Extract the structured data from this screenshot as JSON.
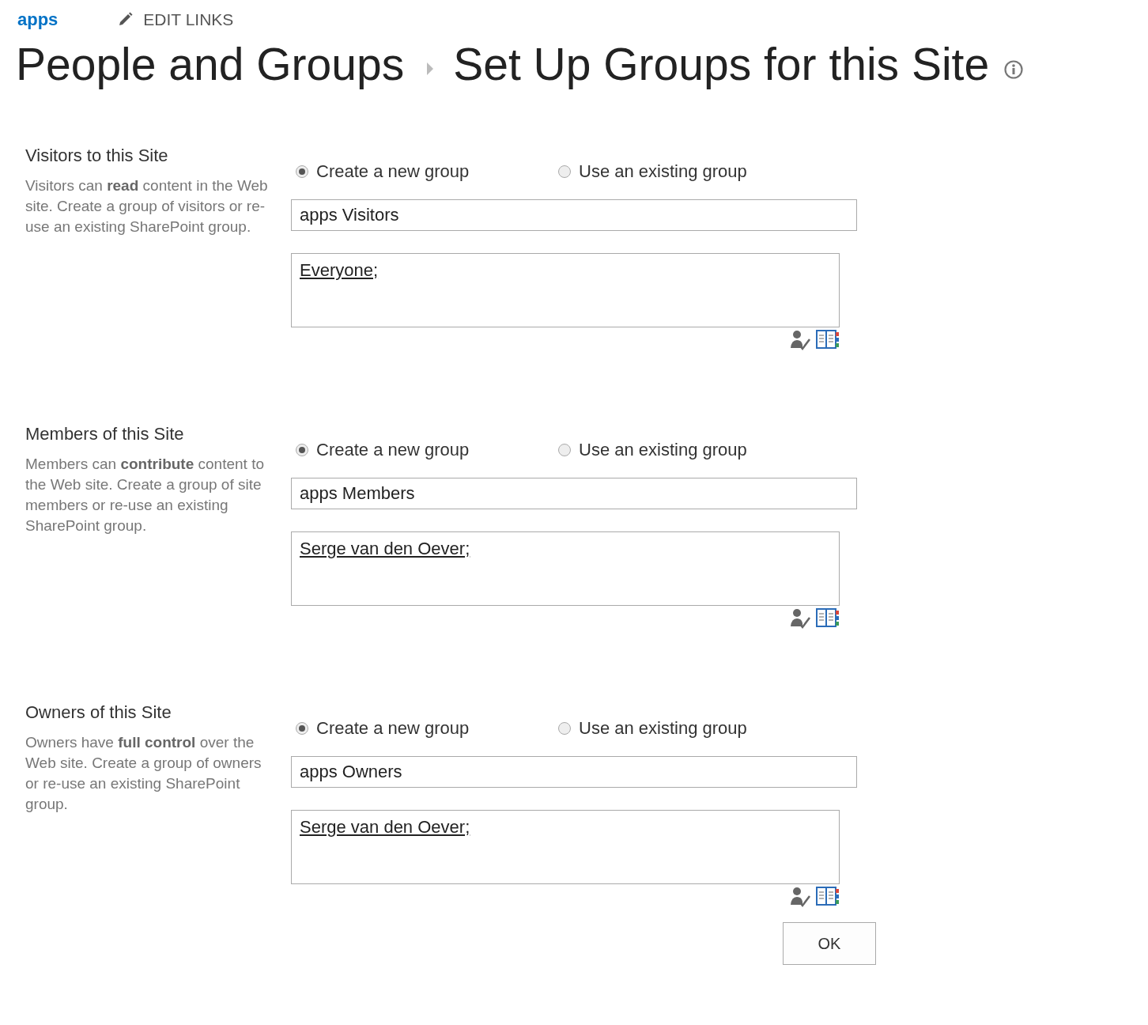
{
  "top_bar": {
    "site_link": "apps",
    "edit_links": "EDIT LINKS"
  },
  "breadcrumb": [
    "People and Groups",
    "Set Up Groups for this Site"
  ],
  "sections": [
    {
      "title": "Visitors to this Site",
      "description": "Visitors can **read** content in the Web site. Create a group of visitors or re-use an existing SharePoint group.",
      "options": [
        {
          "label": "Create a new group",
          "selected": true
        },
        {
          "label": "Use an existing group",
          "selected": false
        }
      ],
      "group_name": "apps Visitors",
      "people": "Everyone;"
    },
    {
      "title": "Members of this Site",
      "description": "Members can **contribute** content to the Web site. Create a group of site members or re-use an existing SharePoint group.",
      "options": [
        {
          "label": "Create a new group",
          "selected": true
        },
        {
          "label": "Use an existing group",
          "selected": false
        }
      ],
      "group_name": "apps Members",
      "people": "Serge van den Oever;"
    },
    {
      "title": "Owners of this Site",
      "description": "Owners have **full control** over the Web site. Create a group of owners or re-use an existing SharePoint group.",
      "options": [
        {
          "label": "Create a new group",
          "selected": true
        },
        {
          "label": "Use an existing group",
          "selected": false
        }
      ],
      "group_name": "apps Owners",
      "people": "Serge van den Oever;"
    }
  ],
  "buttons": [
    "OK"
  ]
}
